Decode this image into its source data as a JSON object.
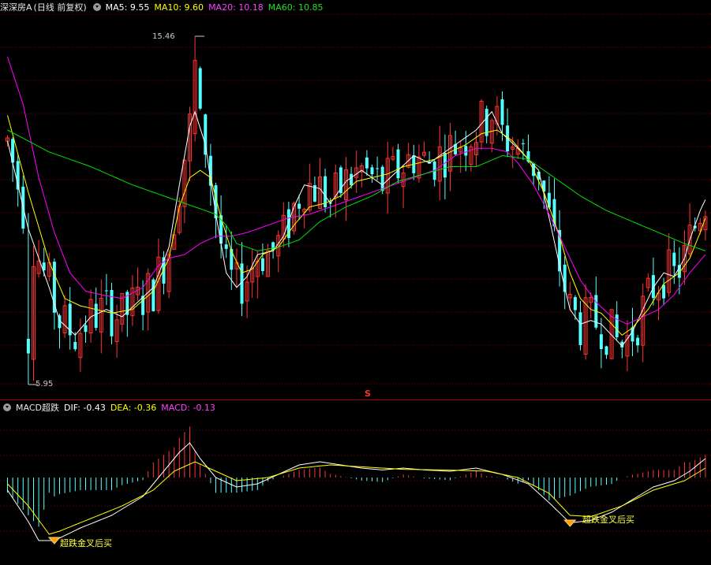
{
  "main_header": {
    "stock_name": "深深房A",
    "period": "(日线 前复权)",
    "ma5_label": "MA5: 9.55",
    "ma10_label": "MA10: 9.60",
    "ma20_label": "MA20: 10.18",
    "ma60_label": "MA60: 10.85"
  },
  "sub_header": {
    "indicator": "MACD超跌",
    "dif_label": "DIF: -0.43",
    "dea_label": "DEA: -0.36",
    "macd_label": "MACD: -0.13"
  },
  "annotations": {
    "high_label": "15.46",
    "low_label": "5.95",
    "s_marker": "S",
    "signal_text": "超跌金叉后买"
  },
  "colors": {
    "background": "#000000",
    "up": "#ff3232",
    "down": "#54ffff",
    "ma5": "#ffffff",
    "ma10": "#ffff00",
    "ma20": "#ff00ff",
    "ma60": "#00e000",
    "grid": "#7a0000",
    "divider": "#a00000"
  },
  "chart_data": [
    {
      "type": "candlestick",
      "title": "深深房A (日线 前复权)",
      "price_range": [
        5.95,
        15.46
      ],
      "high_marker": 15.46,
      "low_marker": 5.95,
      "moving_averages": {
        "MA5": 9.55,
        "MA10": 9.6,
        "MA20": 10.18,
        "MA60": 10.85
      },
      "ma_paths": {
        "MA5": [
          [
            0,
            12.6
          ],
          [
            4,
            10.2
          ],
          [
            8,
            8.6
          ],
          [
            10,
            7.7
          ],
          [
            13,
            7.3
          ],
          [
            16,
            7.8
          ],
          [
            19,
            8.0
          ],
          [
            22,
            7.8
          ],
          [
            25,
            8.2
          ],
          [
            28,
            8.6
          ],
          [
            31,
            9.7
          ],
          [
            33,
            11.4
          ],
          [
            35,
            13.0
          ],
          [
            36,
            13.4
          ],
          [
            38,
            12.5
          ],
          [
            40,
            10.6
          ],
          [
            42,
            9.0
          ],
          [
            44,
            8.6
          ],
          [
            46,
            8.9
          ],
          [
            48,
            9.5
          ],
          [
            51,
            9.6
          ],
          [
            53,
            10.0
          ],
          [
            55,
            10.8
          ],
          [
            57,
            11.4
          ],
          [
            60,
            11.3
          ],
          [
            62,
            10.9
          ],
          [
            65,
            11.5
          ],
          [
            68,
            11.8
          ],
          [
            70,
            11.6
          ],
          [
            72,
            11.4
          ],
          [
            75,
            11.8
          ],
          [
            78,
            12.2
          ],
          [
            81,
            12.0
          ],
          [
            84,
            12.3
          ],
          [
            87,
            12.6
          ],
          [
            90,
            12.9
          ],
          [
            93,
            13.4
          ],
          [
            95,
            12.8
          ],
          [
            98,
            12.4
          ],
          [
            100,
            12.1
          ],
          [
            102,
            11.8
          ],
          [
            104,
            10.5
          ],
          [
            106,
            9.2
          ],
          [
            108,
            8.0
          ],
          [
            110,
            7.6
          ],
          [
            112,
            7.7
          ],
          [
            114,
            7.6
          ],
          [
            116,
            7.3
          ],
          [
            118,
            7.0
          ],
          [
            120,
            7.4
          ],
          [
            122,
            8.0
          ],
          [
            124,
            8.6
          ],
          [
            126,
            9.0
          ],
          [
            128,
            8.9
          ],
          [
            130,
            9.4
          ],
          [
            131,
            9.9
          ],
          [
            133,
            10.7
          ],
          [
            134,
            11.0
          ]
        ],
        "MA10": [
          [
            0,
            13.3
          ],
          [
            4,
            11.2
          ],
          [
            8,
            9.3
          ],
          [
            11,
            8.3
          ],
          [
            14,
            8.1
          ],
          [
            17,
            8.0
          ],
          [
            20,
            7.9
          ],
          [
            24,
            8.0
          ],
          [
            28,
            8.5
          ],
          [
            31,
            9.4
          ],
          [
            33,
            10.8
          ],
          [
            35,
            11.6
          ],
          [
            37,
            11.8
          ],
          [
            39,
            11.6
          ],
          [
            41,
            10.5
          ],
          [
            43,
            9.6
          ],
          [
            45,
            9.0
          ],
          [
            47,
            9.1
          ],
          [
            49,
            9.5
          ],
          [
            52,
            9.7
          ],
          [
            55,
            10.3
          ],
          [
            58,
            10.8
          ],
          [
            61,
            10.9
          ],
          [
            64,
            11.1
          ],
          [
            67,
            11.5
          ],
          [
            70,
            11.6
          ],
          [
            73,
            11.7
          ],
          [
            76,
            11.9
          ],
          [
            79,
            12.0
          ],
          [
            82,
            12.1
          ],
          [
            85,
            12.3
          ],
          [
            88,
            12.5
          ],
          [
            91,
            12.8
          ],
          [
            94,
            12.9
          ],
          [
            97,
            12.6
          ],
          [
            100,
            12.1
          ],
          [
            103,
            11.2
          ],
          [
            106,
            10.0
          ],
          [
            108,
            9.0
          ],
          [
            110,
            8.3
          ],
          [
            112,
            8.0
          ],
          [
            114,
            7.9
          ],
          [
            116,
            7.6
          ],
          [
            118,
            7.3
          ],
          [
            120,
            7.5
          ],
          [
            123,
            8.0
          ],
          [
            126,
            8.7
          ],
          [
            129,
            9.0
          ],
          [
            131,
            9.4
          ],
          [
            133,
            10.1
          ],
          [
            134,
            10.5
          ]
        ],
        "MA20": [
          [
            0,
            14.9
          ],
          [
            3,
            13.6
          ],
          [
            6,
            11.6
          ],
          [
            9,
            10.1
          ],
          [
            12,
            9.0
          ],
          [
            15,
            8.5
          ],
          [
            18,
            8.4
          ],
          [
            22,
            8.3
          ],
          [
            26,
            8.6
          ],
          [
            29,
            9.2
          ],
          [
            31,
            9.4
          ],
          [
            34,
            9.5
          ],
          [
            37,
            9.8
          ],
          [
            40,
            10.0
          ],
          [
            43,
            10.0
          ],
          [
            46,
            10.1
          ],
          [
            50,
            10.3
          ],
          [
            54,
            10.5
          ],
          [
            58,
            10.6
          ],
          [
            62,
            10.8
          ],
          [
            66,
            11.0
          ],
          [
            70,
            11.2
          ],
          [
            74,
            11.4
          ],
          [
            78,
            11.6
          ],
          [
            82,
            11.8
          ],
          [
            86,
            12.2
          ],
          [
            90,
            12.4
          ],
          [
            93,
            12.4
          ],
          [
            96,
            12.3
          ],
          [
            98,
            12.0
          ],
          [
            101,
            11.4
          ],
          [
            104,
            10.6
          ],
          [
            107,
            9.7
          ],
          [
            110,
            8.8
          ],
          [
            113,
            8.2
          ],
          [
            116,
            7.8
          ],
          [
            119,
            7.6
          ],
          [
            122,
            7.8
          ],
          [
            125,
            8.0
          ],
          [
            128,
            8.4
          ],
          [
            131,
            9.0
          ],
          [
            134,
            9.5
          ]
        ],
        "MA60": [
          [
            0,
            12.9
          ],
          [
            8,
            12.3
          ],
          [
            16,
            11.9
          ],
          [
            24,
            11.4
          ],
          [
            30,
            11.1
          ],
          [
            34,
            10.9
          ],
          [
            36,
            10.8
          ],
          [
            40,
            10.6
          ],
          [
            42,
            10.3
          ],
          [
            44,
            9.8
          ],
          [
            48,
            9.6
          ],
          [
            52,
            9.7
          ],
          [
            56,
            9.9
          ],
          [
            60,
            10.4
          ],
          [
            65,
            10.8
          ],
          [
            70,
            11.1
          ],
          [
            75,
            11.5
          ],
          [
            80,
            11.7
          ],
          [
            85,
            11.9
          ],
          [
            90,
            11.9
          ],
          [
            95,
            12.2
          ],
          [
            100,
            12.1
          ],
          [
            104,
            11.7
          ],
          [
            110,
            11.1
          ],
          [
            115,
            10.7
          ],
          [
            120,
            10.4
          ],
          [
            125,
            10.1
          ],
          [
            130,
            9.8
          ],
          [
            134,
            9.6
          ]
        ]
      }
    },
    {
      "type": "histogram",
      "title": "MACD超跌",
      "series": [
        {
          "name": "DIF",
          "value": -0.43
        },
        {
          "name": "DEA",
          "value": -0.36
        },
        {
          "name": "MACD",
          "value": -0.13
        }
      ],
      "signals": [
        {
          "label": "超跌金叉后买",
          "bar": 9
        },
        {
          "label": "超跌金叉后买",
          "bar": 108
        }
      ]
    }
  ]
}
